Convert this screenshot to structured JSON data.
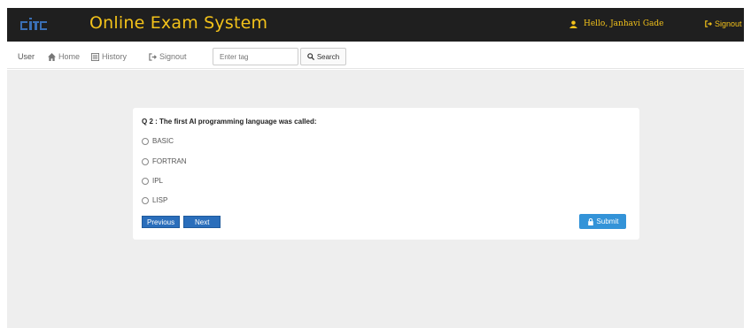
{
  "header": {
    "logo_text": "cit",
    "title": "Online Exam System",
    "greeting": "Hello, Janhavi Gade",
    "signout_label": "Signout"
  },
  "nav": {
    "brand": "User",
    "items": [
      {
        "label": "Home",
        "icon": "home-icon"
      },
      {
        "label": "History",
        "icon": "history-icon"
      },
      {
        "label": "Signout",
        "icon": "signout-icon"
      }
    ],
    "search": {
      "placeholder": "Enter tag",
      "button_label": "Search"
    }
  },
  "question": {
    "text": "Q 2 : The first AI programming language was called:",
    "options": [
      "BASIC",
      "FORTRAN",
      "IPL",
      "LISP"
    ]
  },
  "buttons": {
    "previous": "Previous",
    "next": "Next",
    "submit": "Submit"
  },
  "colors": {
    "header_bg": "#1f1f1f",
    "accent_yellow": "#f3c21a",
    "primary_blue": "#2a6ebb",
    "submit_blue": "#3393d8",
    "page_bg": "#eeeeee"
  }
}
